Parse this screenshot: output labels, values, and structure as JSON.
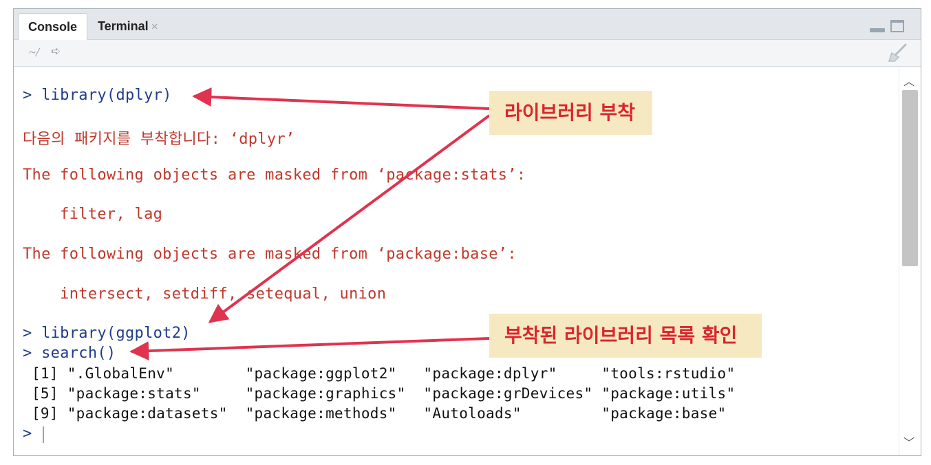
{
  "tabs": [
    {
      "label": "Console",
      "active": true
    },
    {
      "label": "Terminal",
      "close_glyph": "×"
    }
  ],
  "pathbar": {
    "path": "~/",
    "go_icon": "arrow-go-icon",
    "clear_icon": "broom-icon"
  },
  "console": {
    "lines": [
      {
        "kind": "cmd",
        "text": "> library(dplyr)"
      },
      {
        "kind": "msg",
        "text": "다음의 패키지를 부착합니다: ‘dplyr’"
      },
      {
        "kind": "msg",
        "text": "The following objects are masked from ‘package:stats’:"
      },
      {
        "kind": "msg",
        "text": "    filter, lag"
      },
      {
        "kind": "msg",
        "text": "The following objects are masked from ‘package:base’:"
      },
      {
        "kind": "msg",
        "text": "    intersect, setdiff, setequal, union"
      },
      {
        "kind": "cmd",
        "text": "> library(ggplot2)"
      },
      {
        "kind": "cmd",
        "text": "> search()"
      },
      {
        "kind": "out",
        "text": " [1] \".GlobalEnv\"        \"package:ggplot2\"   \"package:dplyr\"     \"tools:rstudio\""
      },
      {
        "kind": "out",
        "text": " [5] \"package:stats\"     \"package:graphics\"  \"package:grDevices\" \"package:utils\""
      },
      {
        "kind": "out",
        "text": " [9] \"package:datasets\"  \"package:methods\"   \"Autoloads\"         \"package:base\""
      },
      {
        "kind": "cmd",
        "text": "> "
      }
    ]
  },
  "annotations": {
    "callout_attach": "라이브러리 부착",
    "callout_list": "부착된 라이브러리 목록 확인"
  },
  "colors": {
    "command": "#1f3c8c",
    "message": "#c0392b",
    "arrow": "#e0334f",
    "callout_bg": "#f6e9c1"
  }
}
